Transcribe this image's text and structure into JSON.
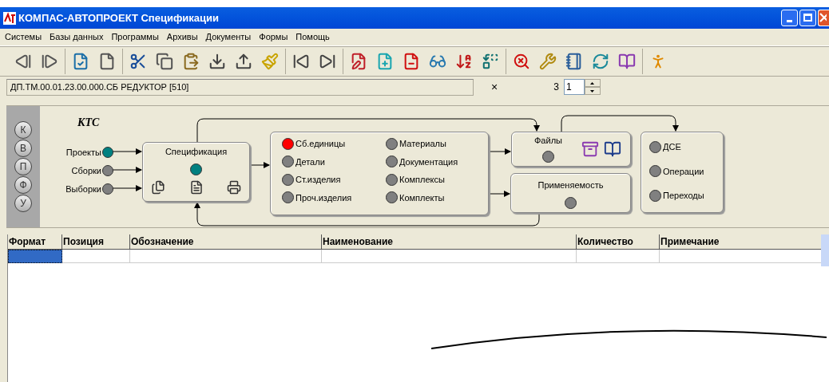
{
  "window": {
    "title": "КОМПАС-АВТОПРОЕКТ Спецификации"
  },
  "menu": [
    "Системы",
    "Базы данных",
    "Программы",
    "Архивы",
    "Документы",
    "Формы",
    "Помощь"
  ],
  "path_bar": {
    "text": "ДП.ТМ.00.01.23.00.000.СБ  РЕДУКТОР [510]",
    "close": "×",
    "count": "3",
    "spin_value": "1"
  },
  "diagram": {
    "title": "КТС",
    "side_buttons": [
      "К",
      "В",
      "П",
      "Ф",
      "У"
    ],
    "inputs": [
      {
        "label": "Проекты",
        "color": "#008080"
      },
      {
        "label": "Сборки",
        "color": "#808080"
      },
      {
        "label": "Выборки",
        "color": "#808080"
      }
    ],
    "spec": {
      "title": "Спецификация",
      "color": "#008080"
    },
    "components": [
      {
        "label": "Сб.единицы",
        "color": "#ff0000"
      },
      {
        "label": "Детали",
        "color": "#808080"
      },
      {
        "label": "Ст.изделия",
        "color": "#808080"
      },
      {
        "label": "Проч.изделия",
        "color": "#808080"
      },
      {
        "label": "Материалы",
        "color": "#808080"
      },
      {
        "label": "Документация",
        "color": "#808080"
      },
      {
        "label": "Комплексы",
        "color": "#808080"
      },
      {
        "label": "Комплекты",
        "color": "#808080"
      }
    ],
    "files": {
      "title": "Файлы",
      "color": "#808080"
    },
    "usage": {
      "title": "Применяемость",
      "color": "#808080"
    },
    "tech": [
      {
        "label": "ДСЕ",
        "color": "#808080"
      },
      {
        "label": "Операции",
        "color": "#808080"
      },
      {
        "label": "Переходы",
        "color": "#808080"
      }
    ]
  },
  "table": {
    "columns": [
      "Формат",
      "Позиция",
      "Обозначение",
      "Наименование",
      "Количество",
      "Примечание"
    ],
    "rows": [
      {
        "cells": [
          {
            "selected": true
          },
          {
            "selected": false
          },
          {
            "selected": false
          },
          {
            "selected": false
          },
          {
            "selected": false
          },
          {
            "selected": false
          }
        ]
      }
    ]
  }
}
